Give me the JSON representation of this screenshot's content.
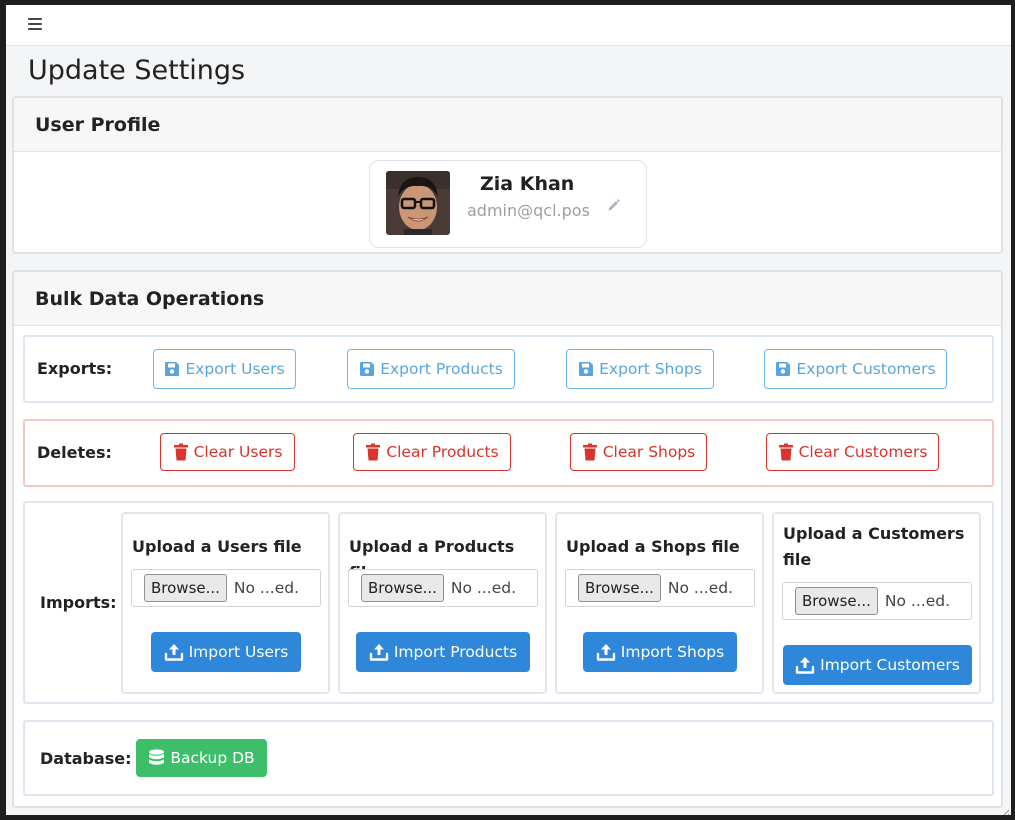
{
  "page": {
    "title": "Update Settings"
  },
  "profile": {
    "header": "User Profile",
    "name": "Zia Khan",
    "email": "admin@qcl.pos"
  },
  "bulk": {
    "header": "Bulk Data Operations",
    "exports": {
      "label": "Exports:",
      "buttons": [
        "Export Users",
        "Export Products",
        "Export Shops",
        "Export Customers"
      ]
    },
    "deletes": {
      "label": "Deletes:",
      "buttons": [
        "Clear Users",
        "Clear Products",
        "Clear Shops",
        "Clear Customers"
      ]
    },
    "imports": {
      "label": "Imports:",
      "cards": [
        {
          "title": "Upload a Users file",
          "browse": "Browse...",
          "status": "No ...ed.",
          "button": "Import Users"
        },
        {
          "title": "Upload a Products file",
          "browse": "Browse...",
          "status": "No ...ed.",
          "button": "Import Products"
        },
        {
          "title": "Upload a Shops file",
          "browse": "Browse...",
          "status": "No ...ed.",
          "button": "Import Shops"
        },
        {
          "title": "Upload a Customers file",
          "browse": "Browse...",
          "status": "No ...ed.",
          "button": "Import Customers"
        }
      ]
    },
    "database": {
      "label": "Database:",
      "button": "Backup DB"
    }
  },
  "icons": {
    "menu": "hamburger-icon",
    "edit": "pencil-icon",
    "export": "floppy-disk-icon",
    "delete": "trash-icon",
    "import": "upload-icon",
    "backup": "database-icon"
  },
  "colors": {
    "info": "#5aa6dc",
    "danger": "#d8332c",
    "primary": "#2e87d9",
    "success": "#3dbf6a"
  }
}
